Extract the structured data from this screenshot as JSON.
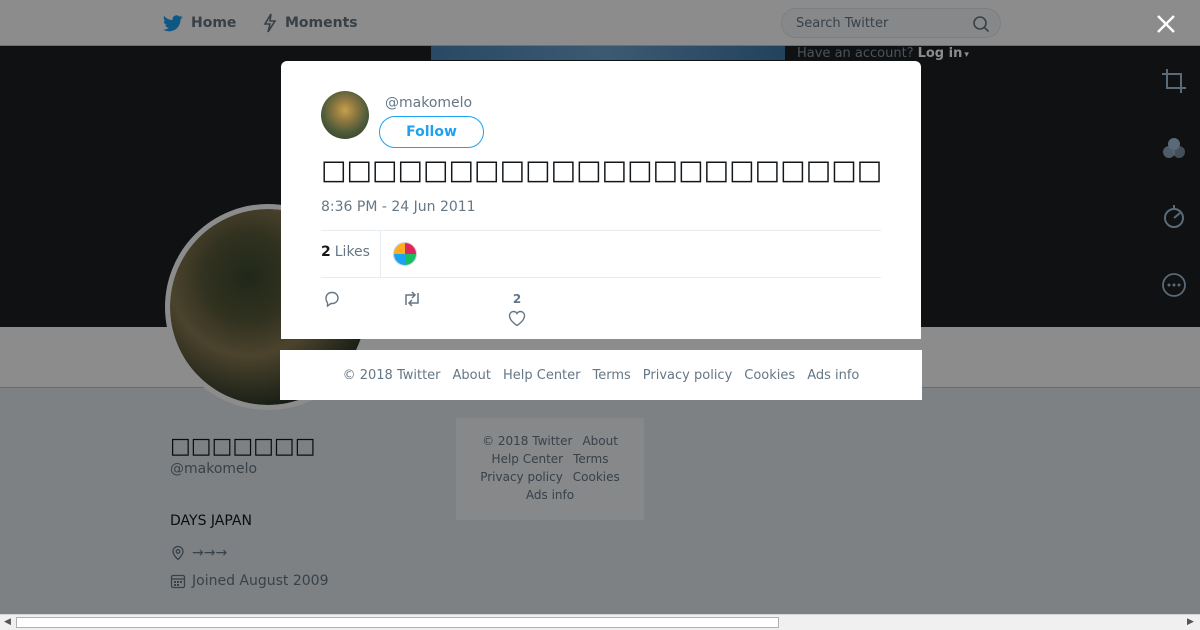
{
  "nav": {
    "home_label": "Home",
    "moments_label": "Moments",
    "search_placeholder": "Search Twitter",
    "have_account": "Have an account?",
    "login_label": "Log in"
  },
  "profile": {
    "name": "□□□□□□□",
    "handle": "@makomelo",
    "bio": "DAYS JAPAN",
    "location": "→→→",
    "joined": "Joined August 2009"
  },
  "page_footer": {
    "copyright": "© 2018 Twitter",
    "links": [
      "About",
      "Help Center",
      "Terms",
      "Privacy policy",
      "Cookies",
      "Ads info"
    ]
  },
  "tweet": {
    "handle": "@makomelo",
    "follow_label": "Follow",
    "text": "□□□□□□□□□□□□□□□□□□□□□□□□□□□□□□□□□□□□□□□□□□□□□□□□□□□□□□□□□□□□□□□□□□□□□□",
    "timestamp": "8:36 PM - 24 Jun 2011",
    "likes_count": "2",
    "likes_label": "Likes",
    "like_action_count": "2"
  },
  "modal_footer": {
    "copyright": "© 2018 Twitter",
    "links": [
      "About",
      "Help Center",
      "Terms",
      "Privacy policy",
      "Cookies",
      "Ads info"
    ]
  },
  "colors": {
    "accent": "#1da1f2",
    "banner": "#1d1f21",
    "overlay": "rgba(0,0,0,0.45)"
  }
}
